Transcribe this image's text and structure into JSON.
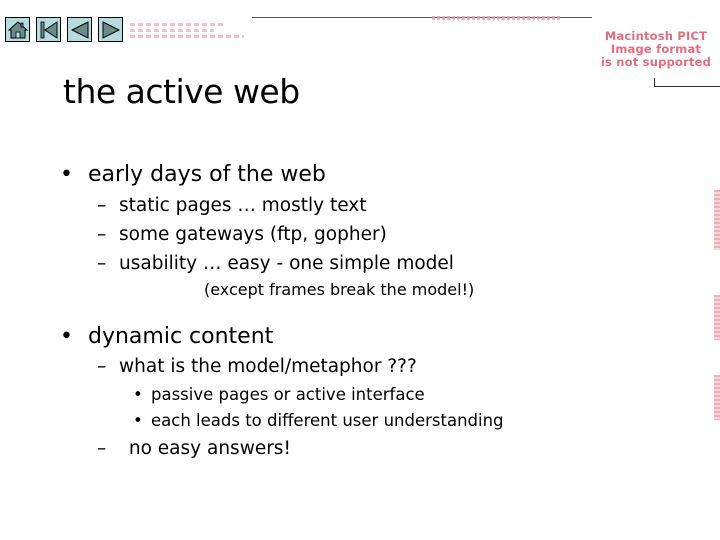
{
  "nav": {
    "buttons": [
      {
        "name": "home",
        "icon": "home-icon"
      },
      {
        "name": "first",
        "icon": "first-slide-icon"
      },
      {
        "name": "previous",
        "icon": "previous-icon"
      },
      {
        "name": "next",
        "icon": "next-icon"
      }
    ],
    "button_color": "#b5dde0"
  },
  "placeholder": {
    "lines": [
      "Macintosh PICT",
      "Image format",
      "is not supported"
    ],
    "color": "#e36d7c"
  },
  "slide": {
    "title": "the active web",
    "bullet_glyph": "•",
    "dash_glyph": "–",
    "sections": [
      {
        "text": "early days of the web",
        "items": [
          {
            "text": "static pages … mostly text"
          },
          {
            "text": "some gateways (ftp, gopher)"
          },
          {
            "text": "usability … easy - one simple model",
            "note": "(except frames break the model!)"
          }
        ]
      },
      {
        "text": "dynamic content",
        "items": [
          {
            "text": "what is the model/metaphor ???",
            "subitems": [
              "passive pages or active interface",
              "each leads to different user understanding"
            ]
          },
          {
            "text": " no easy answers!"
          }
        ]
      }
    ]
  }
}
